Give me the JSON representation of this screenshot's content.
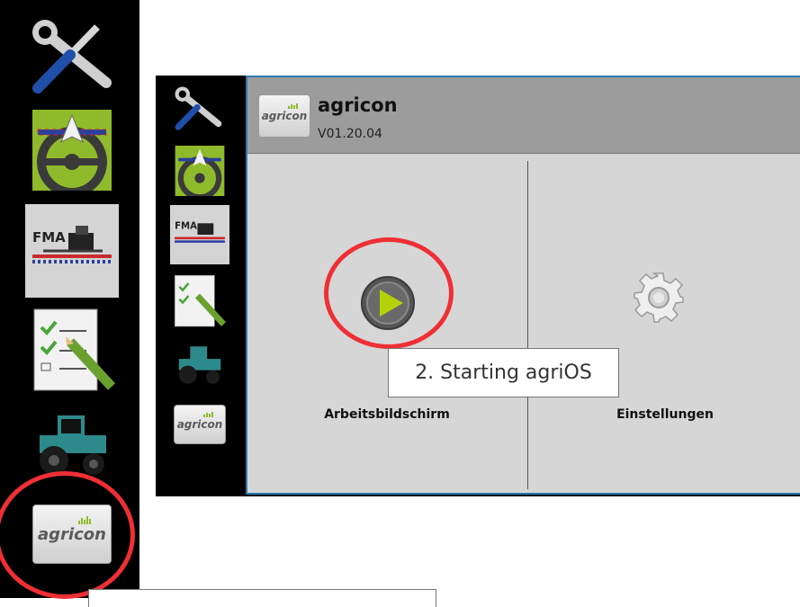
{
  "app": {
    "title": "agricon",
    "version": "V01.20.04",
    "logo_text": "agricon"
  },
  "tiles": {
    "work_screen_label": "Arbeitsbildschirm",
    "settings_label": "Einstellungen"
  },
  "sidebar": {
    "items": [
      {
        "name": "tools-icon"
      },
      {
        "name": "steering-guidance-icon"
      },
      {
        "name": "fma-sprayer-icon",
        "text": "FMA"
      },
      {
        "name": "task-checklist-icon"
      },
      {
        "name": "tractor-icon"
      },
      {
        "name": "agricon-app-icon",
        "text": "agricon"
      }
    ]
  },
  "annotations": {
    "step2": "2. Starting agriOS"
  },
  "colors": {
    "accent_red": "#ef2f35",
    "panel_border": "#2c7ab3",
    "play_green": "#b4d20a",
    "header_gray": "#9c9c9c"
  }
}
